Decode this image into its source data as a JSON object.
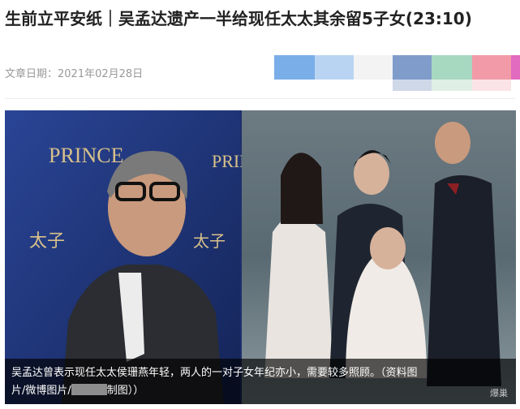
{
  "article": {
    "title": "生前立平安纸｜吴孟达遗产一半给现任太太其余留5子女(23:10)",
    "date_label": "文章日期：",
    "date": "2021年02月28日"
  },
  "photo": {
    "backdrop_brand": "PRINCE",
    "backdrop_brand_cn": "太子",
    "caption_line1": "吴孟达曾表示现任太太侯珊燕年轻，两人的一对子女年纪亦小，需要较多照顾。（资料图",
    "caption_line2_pre": "片/微博图片/",
    "caption_line2_post": "制图））",
    "watermark": "爆巢"
  },
  "colors": {
    "strip": [
      "#7aaee8",
      "#b9d4f3",
      "#f3f3f3",
      "#7f9ccb",
      "#a7d8c0",
      "#f29aa8",
      "#e26abf"
    ],
    "strip_sub": [
      "#ffffff",
      "#ffffff",
      "#ffffff",
      "#cfd8e8",
      "#e0efe6",
      "#fbe3e7",
      "#ffffff"
    ]
  }
}
